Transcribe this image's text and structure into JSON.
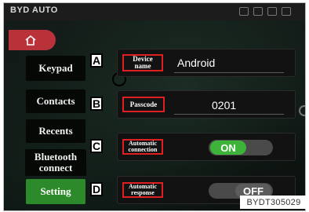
{
  "topbar": {
    "brand": "BYD AUTO"
  },
  "nav": {
    "home_label": "",
    "items": [
      {
        "label": "Keypad"
      },
      {
        "label": "Contacts"
      },
      {
        "label": "Recents"
      },
      {
        "label": "Bluetooth connect"
      },
      {
        "label": "Setting"
      }
    ]
  },
  "settings": {
    "rows": [
      {
        "marker": "A",
        "label": "Device name",
        "value": "Android"
      },
      {
        "marker": "B",
        "label": "Passcode",
        "value": "0201"
      },
      {
        "marker": "C",
        "label": "Automatic connection",
        "toggle": "ON"
      },
      {
        "marker": "D",
        "label": "Automatic response",
        "toggle": "OFF"
      }
    ]
  },
  "colors": {
    "active": "#2d8a2a",
    "highlight": "#e02020",
    "home": "#b9323a"
  },
  "watermark": "BYDT305029"
}
